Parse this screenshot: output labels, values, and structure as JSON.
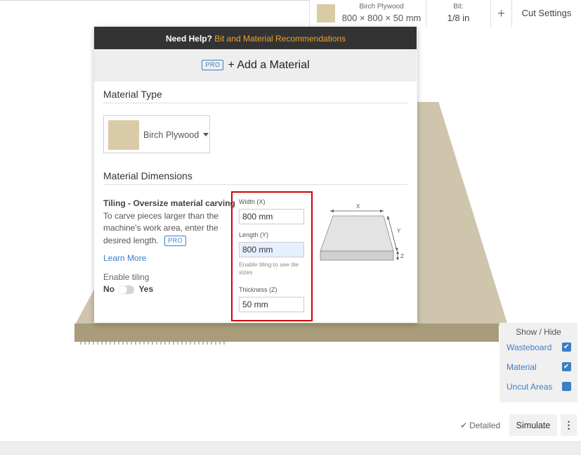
{
  "toolbar": {
    "material_name": "Birch Plywood",
    "material_dims": "800 × 800 × 50 mm",
    "bit_label": "Bit:",
    "bit_value": "1/8 in",
    "add_label": "+",
    "cut_settings_label": "Cut Settings"
  },
  "modal": {
    "help_prefix": "Need Help?",
    "help_link": "Bit and Material Recommendations",
    "pro_badge": "PRO",
    "title": "+ Add a Material",
    "material_type_heading": "Material Type",
    "material_select_value": "Birch Plywood",
    "dimensions_heading": "Material Dimensions",
    "tiling_title": "Tiling - Oversize material carving",
    "tiling_desc": "To carve pieces larger than the machine's work area, enter the desired length.",
    "tiling_pro_badge": "PRO",
    "learn_more": "Learn More",
    "enable_tiling": "Enable tiling",
    "toggle_no": "No",
    "toggle_yes": "Yes",
    "width_label": "Width (X)",
    "width_value": "800 mm",
    "length_label": "Length (Y)",
    "length_value": "800 mm",
    "length_hint": "Enable tiling to see tile sizes",
    "thickness_label": "Thickness (Z)",
    "thickness_value": "50 mm",
    "diagram": {
      "x_label": "X",
      "y_label": "Y",
      "z_label": "Z"
    }
  },
  "show_hide": {
    "title": "Show / Hide",
    "items": [
      {
        "label": "Wasteboard",
        "checked": true
      },
      {
        "label": "Material",
        "checked": true
      },
      {
        "label": "Uncut Areas",
        "checked": false
      }
    ]
  },
  "bottom": {
    "detailed_label": "Detailed",
    "simulate_label": "Simulate",
    "more_label": "⋮"
  },
  "colors": {
    "accent_blue": "#3b7fc4",
    "help_link_orange": "#f0a12a",
    "highlight_red": "#d50000",
    "material_swatch": "#d9cba7"
  }
}
